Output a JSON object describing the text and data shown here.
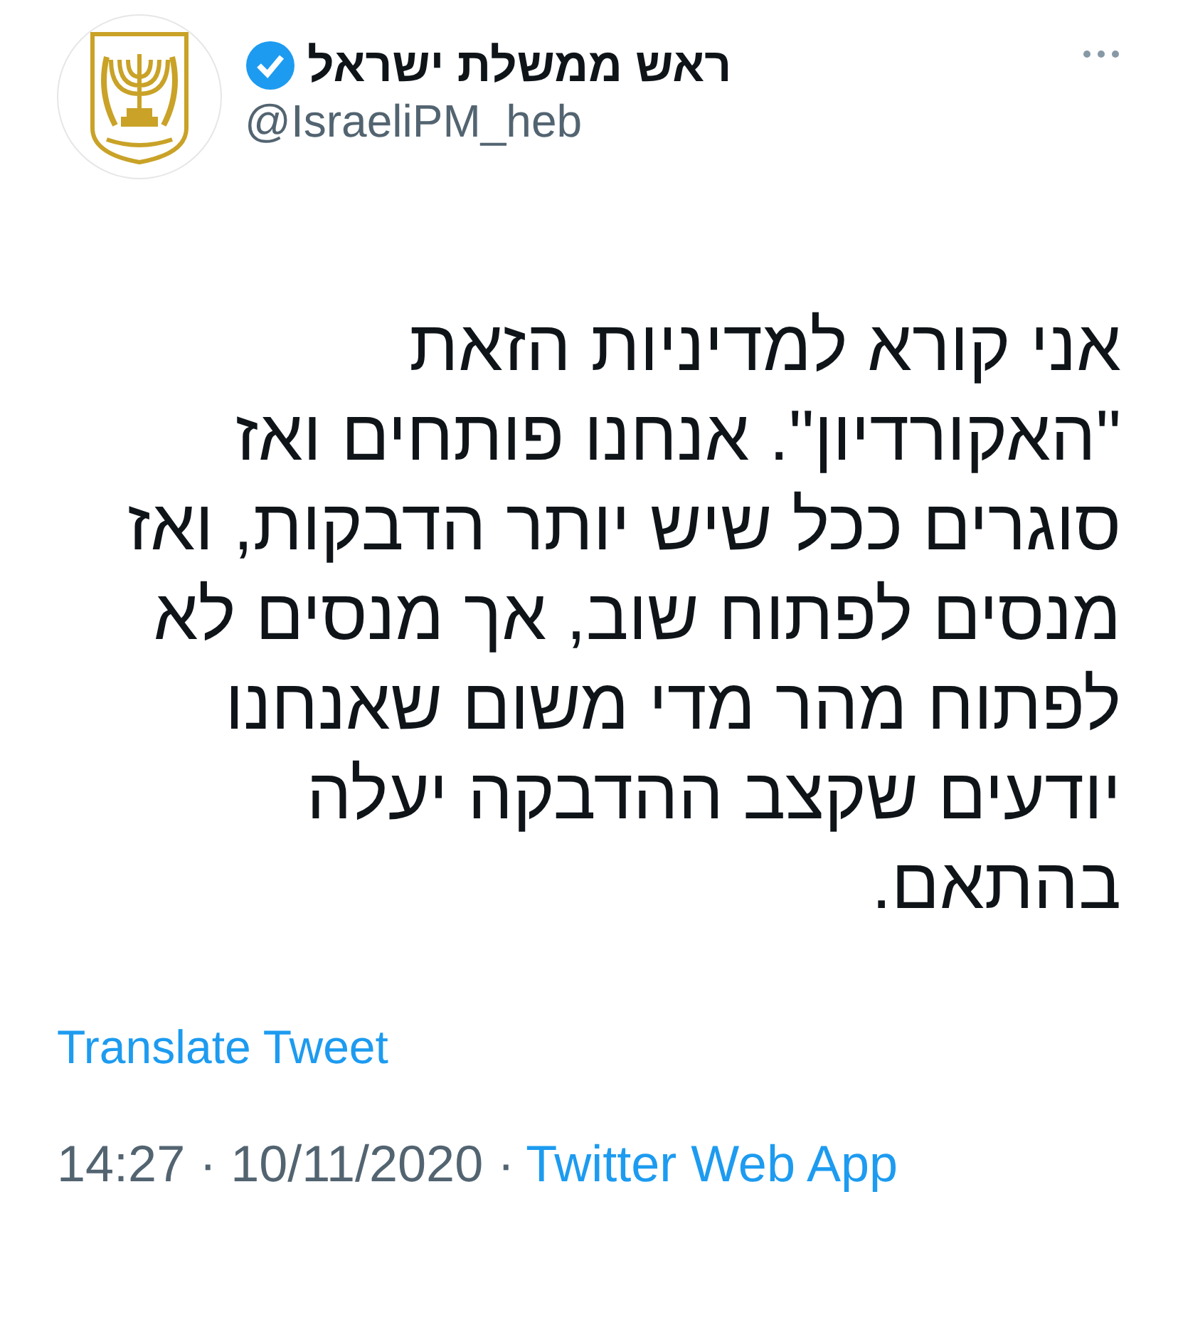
{
  "account": {
    "name": "ראש ממשלת ישראל",
    "verified": true,
    "handle": "@IsraeliPM_heb"
  },
  "text": "אני קורא למדיניות הזאת \"האקורדיון\". אנחנו פותחים ואז סוגרים ככל שיש יותר הדבקות, ואז מנסים לפתוח שוב, אך מנסים לא לפתוח מהר מדי משום שאנחנו יודעים שקצב ההדבקה יעלה בהתאם.",
  "translate": "Translate Tweet",
  "meta": {
    "time": "14:27 · 10/11/2020 ·",
    "source": "Twitter Web App"
  }
}
